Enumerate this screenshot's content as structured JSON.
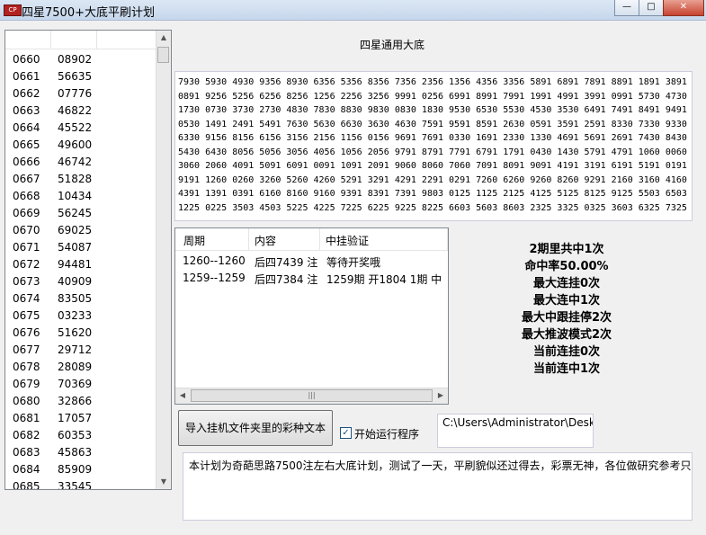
{
  "window": {
    "title": "四星7500+大底平刷计划",
    "icon_text": "CP",
    "minimize": "—",
    "maximize": "□",
    "close": "✕"
  },
  "left_list": {
    "rows": [
      {
        "period": "0660",
        "number": "08902"
      },
      {
        "period": "0661",
        "number": "56635"
      },
      {
        "period": "0662",
        "number": "07776"
      },
      {
        "period": "0663",
        "number": "46822"
      },
      {
        "period": "0664",
        "number": "45522"
      },
      {
        "period": "0665",
        "number": "49600"
      },
      {
        "period": "0666",
        "number": "46742"
      },
      {
        "period": "0667",
        "number": "51828"
      },
      {
        "period": "0668",
        "number": "10434"
      },
      {
        "period": "0669",
        "number": "56245"
      },
      {
        "period": "0670",
        "number": "69025"
      },
      {
        "period": "0671",
        "number": "54087"
      },
      {
        "period": "0672",
        "number": "94481"
      },
      {
        "period": "0673",
        "number": "40909"
      },
      {
        "period": "0674",
        "number": "83505"
      },
      {
        "period": "0675",
        "number": "03233"
      },
      {
        "period": "0676",
        "number": "51620"
      },
      {
        "period": "0677",
        "number": "29712"
      },
      {
        "period": "0678",
        "number": "28089"
      },
      {
        "period": "0679",
        "number": "70369"
      },
      {
        "period": "0680",
        "number": "32866"
      },
      {
        "period": "0681",
        "number": "17057"
      },
      {
        "period": "0682",
        "number": "60353"
      },
      {
        "period": "0683",
        "number": "45863"
      },
      {
        "period": "0684",
        "number": "85909"
      },
      {
        "period": "0685",
        "number": "33545"
      }
    ]
  },
  "main": {
    "heading": "四星通用大底",
    "numbers_lines": [
      "7930 5930 4930 9356 8930 6356 5356 8356 7356 2356 1356 4356 3356 5891 6891 7891 8891 1891 3891 2930 1930",
      "0891 9256 5256 6256 8256 1256 2256 3256 9991 0256 6991 8991 7991 1991 4991 3991 0991 5730 4730 7730 6730",
      "1730 0730 3730 2730 4830 7830 8830 9830 0830 1830 9530 6530 5530 4530 3530 6491 7491 8491 9491 2530 1530",
      "0530 1491 2491 5491 7630 5630 6630 3630 4630 7591 9591 8591 2630 0591 3591 2591 8330 7330 9330 4330 3330",
      "6330 9156 8156 6156 3156 2156 1156 0156 9691 7691 0330 1691 2330 1330 4691 5691 2691 7430 8430 9430 4430",
      "5430 6430 8056 5056 3056 4056 1056 2056 9791 8791 7791 6791 1791 0430 1430 5791 4791 1060 0060 5060 4060",
      "3060 2060 4091 5091 6091 0091 1091 2091 9060 8060 7060 7091 8091 9091 4191 3191 6191 5191 0191 8191 7191",
      "9191 1260 0260 3260 5260 4260 5291 3291 4291 2291 0291 7260 6260 9260 8260 9291 2160 3160 4160 5160 5391",
      "4391 1391 0391 6160 8160 9160 9391 8391 7391 9803 0125 1125 2125 4125 5125 8125 9125 5503 6503 7503 8503",
      "1225 0225 3503 4503 5225 4225 7225 6225 9225 8225 6603 5603 8603 2325 3325 0325 3603 6325 7325 0603 9325"
    ]
  },
  "result_table": {
    "headers": [
      "周期",
      "内容",
      "中挂验证"
    ],
    "rows": [
      {
        "period": "1260--1260",
        "content": "后四7439 注",
        "check": "等待开奖哦"
      },
      {
        "period": "1259--1259",
        "content": "后四7384 注",
        "check": "1259期 开1804 1期 中"
      }
    ],
    "scroll_grip": "|||"
  },
  "stats": [
    "2期里共中1次",
    "命中率50.00%",
    "最大连挂0次",
    "最大连中1次",
    "最大中跟挂停2次",
    "最大推波模式2次",
    "当前连挂0次",
    "当前连中1次"
  ],
  "controls": {
    "import_button": "导入挂机文件夹里的彩种文本",
    "run_checkbox_label": "开始运行程序",
    "run_checked": true,
    "path_value": "C:\\Users\\Administrator\\Desktop",
    "note_text": "本计划为奇葩思路7500注左右大底计划，测试了一天，平刷貌似还过得去，彩票无神，各位做研究参考只是"
  }
}
